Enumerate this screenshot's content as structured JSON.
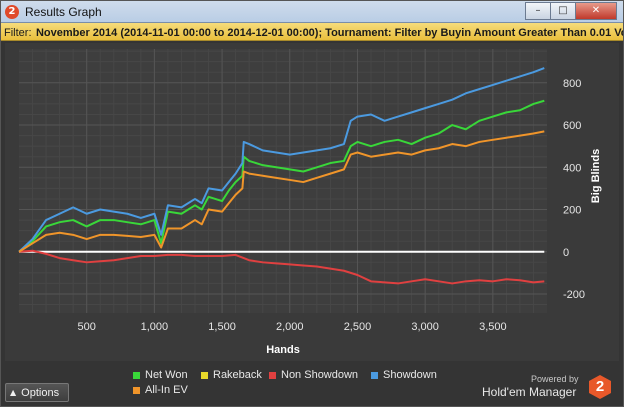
{
  "window": {
    "title": "Results Graph",
    "app_icon_glyph": "2",
    "controls": [
      "minimize-icon",
      "maximize-icon",
      "close-icon"
    ]
  },
  "filter": {
    "label": "Filter:",
    "text": "November 2014 (2014-11-01 00:00 to 2014-12-01 00:00); Tournament: Filter by Buyin Amount Greater Than 0.01 Vo"
  },
  "options_button": {
    "label": "Options",
    "icon": "caret-up-icon"
  },
  "branding": {
    "powered_by": "Powered by",
    "product": "Hold'em Manager",
    "logo_glyph": "2",
    "logo_color": "#e8582a"
  },
  "chart_data": {
    "type": "line",
    "xlabel": "Hands",
    "ylabel": "Big Blinds",
    "xlim": [
      0,
      3900
    ],
    "ylim": [
      -290,
      960
    ],
    "x_ticks": [
      500,
      1000,
      1500,
      2000,
      2500,
      3000,
      3500
    ],
    "x_tick_labels": [
      "500",
      "1,000",
      "1,500",
      "2,000",
      "2,500",
      "3,000",
      "3,500"
    ],
    "y_ticks": [
      -200,
      0,
      200,
      400,
      600,
      800
    ],
    "y_tick_labels": [
      "-200",
      "0",
      "200",
      "400",
      "600",
      "800"
    ],
    "grid": true,
    "legend_position": "bottom",
    "series": [
      {
        "name": "Net Won",
        "color": "#39d739",
        "x": [
          0,
          100,
          200,
          300,
          400,
          500,
          600,
          700,
          800,
          900,
          1000,
          1050,
          1100,
          1200,
          1300,
          1350,
          1400,
          1500,
          1550,
          1600,
          1650,
          1660,
          1700,
          1800,
          1900,
          2000,
          2100,
          2200,
          2300,
          2400,
          2450,
          2500,
          2600,
          2700,
          2800,
          2900,
          3000,
          3100,
          3200,
          3300,
          3400,
          3500,
          3600,
          3700,
          3800,
          3880
        ],
        "values": [
          0,
          50,
          120,
          140,
          150,
          120,
          150,
          150,
          140,
          130,
          150,
          40,
          190,
          180,
          220,
          200,
          260,
          240,
          290,
          330,
          360,
          450,
          430,
          410,
          400,
          390,
          380,
          400,
          420,
          430,
          500,
          520,
          500,
          520,
          530,
          510,
          540,
          560,
          600,
          580,
          620,
          640,
          660,
          670,
          700,
          715
        ]
      },
      {
        "name": "Rakeback",
        "color": "#e8d82a",
        "x": [
          0,
          3880
        ],
        "values": [
          0,
          0
        ]
      },
      {
        "name": "Non Showdown",
        "color": "#e04040",
        "x": [
          0,
          100,
          200,
          300,
          400,
          500,
          600,
          700,
          800,
          900,
          1000,
          1100,
          1200,
          1300,
          1400,
          1500,
          1600,
          1700,
          1800,
          1900,
          2000,
          2100,
          2200,
          2300,
          2400,
          2500,
          2600,
          2700,
          2800,
          2900,
          3000,
          3100,
          3200,
          3300,
          3400,
          3500,
          3600,
          3700,
          3800,
          3880
        ],
        "values": [
          0,
          5,
          -10,
          -30,
          -40,
          -50,
          -45,
          -40,
          -30,
          -20,
          -20,
          -15,
          -15,
          -20,
          -20,
          -20,
          -15,
          -40,
          -50,
          -55,
          -60,
          -65,
          -70,
          -80,
          -90,
          -110,
          -140,
          -145,
          -150,
          -140,
          -130,
          -140,
          -150,
          -140,
          -135,
          -140,
          -130,
          -135,
          -145,
          -140
        ]
      },
      {
        "name": "Showdown",
        "color": "#4b9ae0",
        "x": [
          0,
          100,
          200,
          300,
          400,
          500,
          600,
          700,
          800,
          900,
          1000,
          1050,
          1100,
          1200,
          1300,
          1350,
          1400,
          1500,
          1550,
          1600,
          1650,
          1660,
          1700,
          1800,
          1900,
          2000,
          2100,
          2200,
          2300,
          2400,
          2450,
          2500,
          2600,
          2700,
          2800,
          2900,
          3000,
          3100,
          3200,
          3300,
          3400,
          3500,
          3600,
          3700,
          3800,
          3880
        ],
        "values": [
          0,
          60,
          150,
          180,
          210,
          180,
          200,
          190,
          180,
          160,
          180,
          80,
          220,
          210,
          250,
          230,
          300,
          290,
          330,
          370,
          420,
          520,
          510,
          480,
          470,
          460,
          470,
          480,
          490,
          510,
          620,
          640,
          650,
          620,
          640,
          660,
          680,
          700,
          720,
          750,
          770,
          790,
          810,
          830,
          850,
          870
        ]
      },
      {
        "name": "All-In EV",
        "color": "#f0952a",
        "x": [
          0,
          100,
          200,
          300,
          400,
          500,
          600,
          700,
          800,
          900,
          1000,
          1050,
          1100,
          1200,
          1300,
          1350,
          1400,
          1500,
          1550,
          1600,
          1650,
          1660,
          1700,
          1800,
          1900,
          2000,
          2100,
          2200,
          2300,
          2400,
          2450,
          2500,
          2600,
          2700,
          2800,
          2900,
          3000,
          3100,
          3200,
          3300,
          3400,
          3500,
          3600,
          3700,
          3800,
          3880
        ],
        "values": [
          0,
          40,
          80,
          90,
          80,
          60,
          80,
          80,
          75,
          70,
          80,
          20,
          110,
          110,
          150,
          130,
          200,
          190,
          230,
          270,
          300,
          380,
          370,
          360,
          350,
          340,
          330,
          350,
          370,
          390,
          460,
          470,
          450,
          460,
          470,
          460,
          480,
          490,
          510,
          500,
          520,
          530,
          540,
          550,
          560,
          570
        ]
      }
    ]
  }
}
